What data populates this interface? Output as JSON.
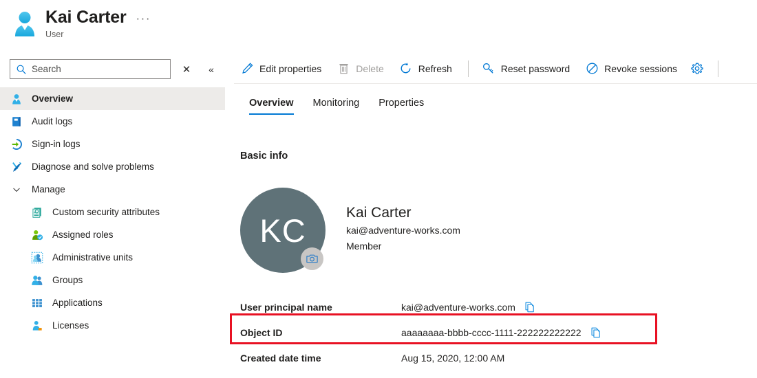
{
  "header": {
    "title": "Kai Carter",
    "subtitle": "User",
    "more_label": "···",
    "avatar_icon": "user-icon"
  },
  "search": {
    "placeholder": "Search",
    "value": "",
    "search_icon": "search-icon",
    "close_label": "✕",
    "collapse_label": "«"
  },
  "sidebar": {
    "items": [
      {
        "label": "Overview",
        "icon": "user-icon",
        "selected": true,
        "level": 0
      },
      {
        "label": "Audit logs",
        "icon": "book-icon",
        "selected": false,
        "level": 0
      },
      {
        "label": "Sign-in logs",
        "icon": "sign-in-arrow-icon",
        "selected": false,
        "level": 0
      },
      {
        "label": "Diagnose and solve problems",
        "icon": "wrench-screwdriver-icon",
        "selected": false,
        "level": 0
      },
      {
        "label": "Manage",
        "icon": "chevron-down-icon",
        "selected": false,
        "level": 0,
        "group": true
      },
      {
        "label": "Custom security attributes",
        "icon": "security-attributes-icon",
        "selected": false,
        "level": 1
      },
      {
        "label": "Assigned roles",
        "icon": "assigned-roles-icon",
        "selected": false,
        "level": 1
      },
      {
        "label": "Administrative units",
        "icon": "administrative-units-icon",
        "selected": false,
        "level": 1
      },
      {
        "label": "Groups",
        "icon": "groups-icon",
        "selected": false,
        "level": 1
      },
      {
        "label": "Applications",
        "icon": "applications-grid-icon",
        "selected": false,
        "level": 1
      },
      {
        "label": "Licenses",
        "icon": "licenses-icon",
        "selected": false,
        "level": 1
      }
    ]
  },
  "toolbar": {
    "buttons": [
      {
        "label": "Edit properties",
        "icon": "pencil-icon",
        "disabled": false
      },
      {
        "label": "Delete",
        "icon": "trash-icon",
        "disabled": true
      },
      {
        "label": "Refresh",
        "icon": "refresh-icon",
        "disabled": false
      },
      {
        "separator": true
      },
      {
        "label": "Reset password",
        "icon": "key-icon",
        "disabled": false
      },
      {
        "label": "Revoke sessions",
        "icon": "no-entry-icon",
        "disabled": false
      },
      {
        "label": "",
        "icon": "gear-icon",
        "disabled": false,
        "icon_only": true
      }
    ]
  },
  "tabs": [
    {
      "label": "Overview",
      "active": true
    },
    {
      "label": "Monitoring",
      "active": false
    },
    {
      "label": "Properties",
      "active": false
    }
  ],
  "content": {
    "section_title": "Basic info",
    "avatar_initials": "KC",
    "camera_icon": "camera-icon",
    "profile_name": "Kai Carter",
    "profile_email": "kai@adventure-works.com",
    "profile_type": "Member",
    "details": [
      {
        "label": "User principal name",
        "value": "kai@adventure-works.com",
        "copy": true,
        "highlighted": false
      },
      {
        "label": "Object ID",
        "value": "aaaaaaaa-bbbb-cccc-1111-222222222222",
        "copy": true,
        "highlighted": true
      },
      {
        "label": "Created date time",
        "value": "Aug 15, 2020, 12:00 AM",
        "copy": false,
        "highlighted": false
      }
    ]
  },
  "colors": {
    "accent": "#0078d4",
    "highlight_border": "#e81123",
    "avatar_bg": "#5f7278",
    "selected_nav_bg": "#edebe9"
  }
}
